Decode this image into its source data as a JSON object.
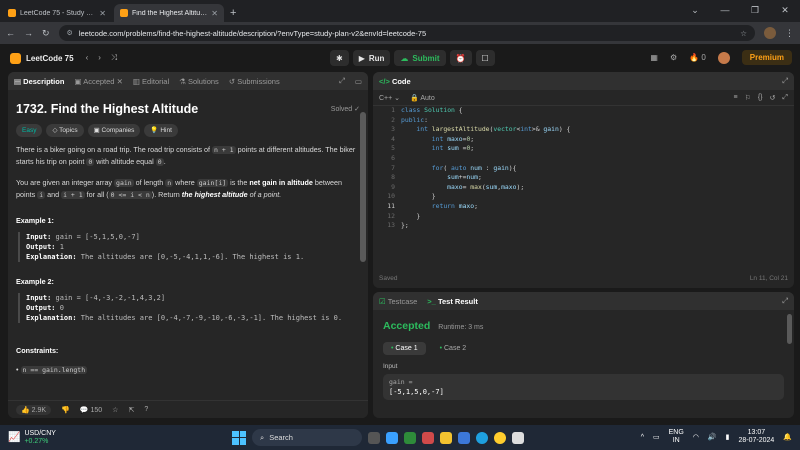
{
  "browser": {
    "tabs": [
      {
        "title": "LeetCode 75 - Study Plan - Lee",
        "active": false
      },
      {
        "title": "Find the Highest Altitude - Lee",
        "active": true
      }
    ],
    "new_tab": "+",
    "url": "leetcode.com/problems/find-the-highest-altitude/description/?envType=study-plan-v2&envId=leetcode-75"
  },
  "lcnav": {
    "plan": "LeetCode 75",
    "run": "Run",
    "submit": "Submit",
    "streak": "0",
    "premium": "Premium"
  },
  "left": {
    "tabs": [
      "Description",
      "Accepted",
      "Editorial",
      "Solutions",
      "Submissions"
    ],
    "title": "1732. Find the Highest Altitude",
    "status": "Solved",
    "tags": [
      "Easy",
      "Topics",
      "Companies",
      "Hint"
    ],
    "p1": {
      "a": "There is a biker going on a road trip. The road trip consists of ",
      "c1": "n + 1",
      "b": " points at different altitudes. The biker starts his trip on point ",
      "c2": "0",
      "d": " with altitude equal ",
      "c3": "0",
      "e": "."
    },
    "p2": {
      "a": "You are given an integer array ",
      "c1": "gain",
      "b": " of length ",
      "c2": "n",
      "c": " where ",
      "c3": "gain[i]",
      "d": " is the ",
      "bold1": "net gain in altitude",
      "e": " between points ",
      "c4": "i",
      "f": " and ",
      "c5": "i + 1",
      "g": " for all (",
      "c6": "0 <= i < n",
      "h": "). Return ",
      "bold2": "the highest altitude",
      "i": " of a point."
    },
    "examples": [
      {
        "heading": "Example 1:",
        "input_label": "Input:",
        "input": "gain = [-5,1,5,0,-7]",
        "output_label": "Output:",
        "output": "1",
        "expl_label": "Explanation:",
        "explanation": "The altitudes are [0,-5,-4,1,1,-6]. The highest is 1."
      },
      {
        "heading": "Example 2:",
        "input_label": "Input:",
        "input": "gain = [-4,-3,-2,-1,4,3,2]",
        "output_label": "Output:",
        "output": "0",
        "expl_label": "Explanation:",
        "explanation": "The altitudes are [0,-4,-7,-9,-10,-6,-3,-1]. The highest is 0."
      }
    ],
    "constraints_heading": "Constraints:",
    "constraint1": "n == gain.length",
    "likes": "2.9K",
    "comments": "150"
  },
  "editor": {
    "title": "Code",
    "language": "C++",
    "mode": "Auto",
    "line_numbers": [
      "1",
      "2",
      "3",
      "4",
      "5",
      "6",
      "7",
      "8",
      "9",
      "10",
      "11",
      "12",
      "13"
    ],
    "saved": "Saved",
    "cursor": "Ln 11, Col 21"
  },
  "result": {
    "tabs": [
      "Testcase",
      "Test Result"
    ],
    "verdict": "Accepted",
    "runtime": "Runtime: 3 ms",
    "cases": [
      "Case 1",
      "Case 2"
    ],
    "input_label": "Input",
    "var": "gain =",
    "value": "[-5,1,5,0,-7]"
  },
  "taskbar": {
    "ticker": "USD/CNY",
    "change": "+0.27%",
    "search": "Search",
    "lang1": "ENG",
    "lang2": "IN",
    "time": "13:07",
    "date": "28-07-2024"
  }
}
